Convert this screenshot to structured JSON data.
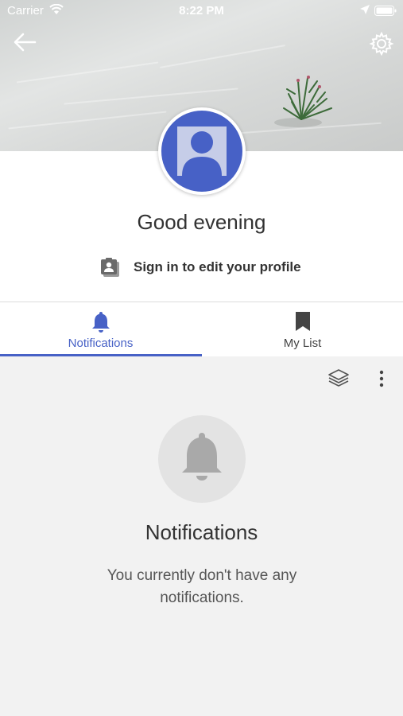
{
  "status_bar": {
    "carrier": "Carrier",
    "time": "8:22 PM"
  },
  "header": {
    "background": "sand-with-plant"
  },
  "profile": {
    "greeting": "Good evening",
    "signin_label": "Sign in to edit your profile",
    "accent": "#4761c6"
  },
  "tabs": [
    {
      "label": "Notifications",
      "icon": "bell-icon",
      "selected": true
    },
    {
      "label": "My List",
      "icon": "bookmark-icon",
      "selected": false
    }
  ],
  "toolbar": {
    "layers_icon": "layers-icon",
    "more_icon": "more-vert-icon"
  },
  "empty_state": {
    "icon": "bell-icon",
    "title": "Notifications",
    "message": "You currently don't have any notifications."
  },
  "colors": {
    "tab_active": "#4761c6",
    "tab_inactive": "#444444",
    "content_bg": "#f2f2f2"
  }
}
